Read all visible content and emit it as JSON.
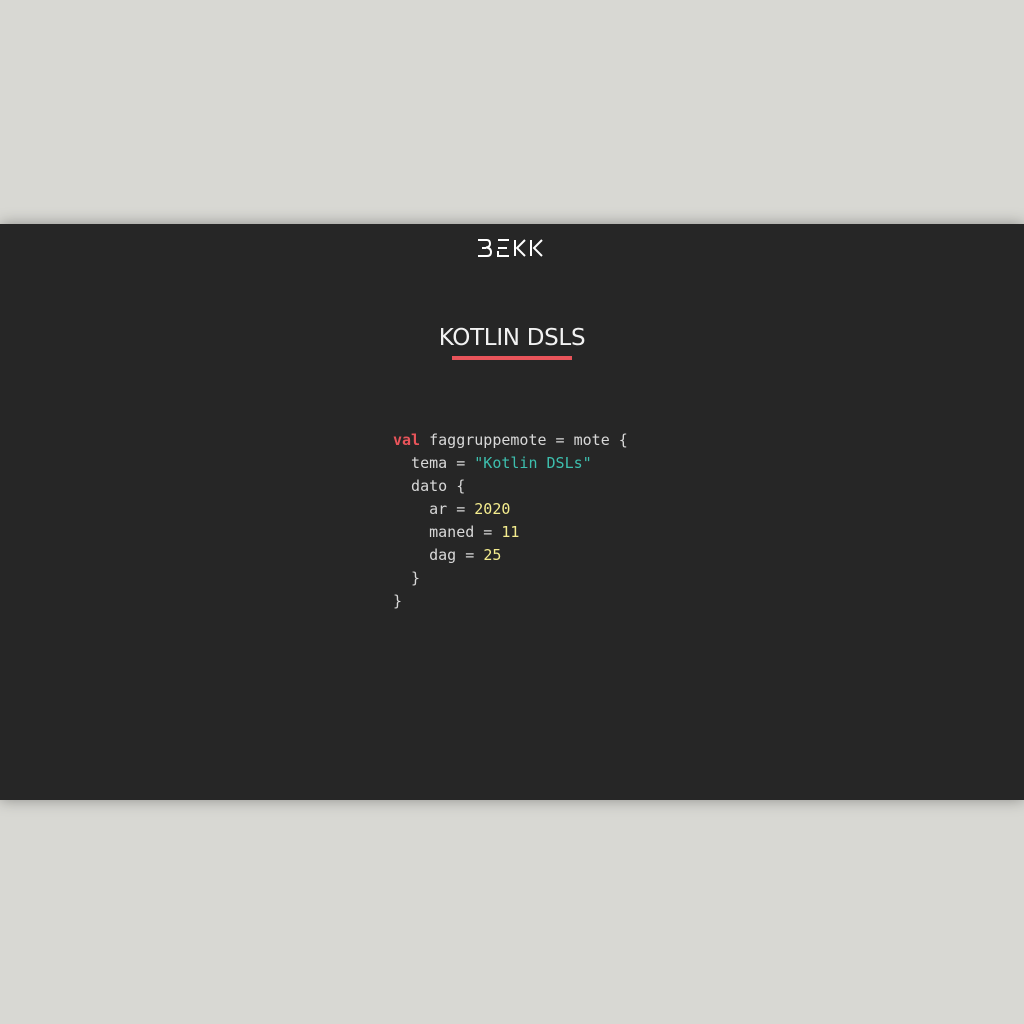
{
  "slide": {
    "logo_text": "BEKK",
    "title": "KOTLIN DSLS",
    "accent_color": "#e8545a"
  },
  "code": {
    "line1": {
      "keyword": "val",
      "rest": " faggruppemote = mote {"
    },
    "line2": {
      "prefix": "  tema = ",
      "string": "\"Kotlin DSLs\""
    },
    "line3": {
      "text": "  dato {"
    },
    "line4": {
      "prefix": "    ar = ",
      "number": "2020"
    },
    "line5": {
      "prefix": "    maned = ",
      "number": "11"
    },
    "line6": {
      "prefix": "    dag = ",
      "number": "25"
    },
    "line7": {
      "text": "  }"
    },
    "line8": {
      "text": "}"
    }
  },
  "colors": {
    "background": "#d8d8d3",
    "slide": "#262626",
    "keyword": "#e8545a",
    "string": "#3dbfae",
    "number": "#f4ec8e"
  }
}
